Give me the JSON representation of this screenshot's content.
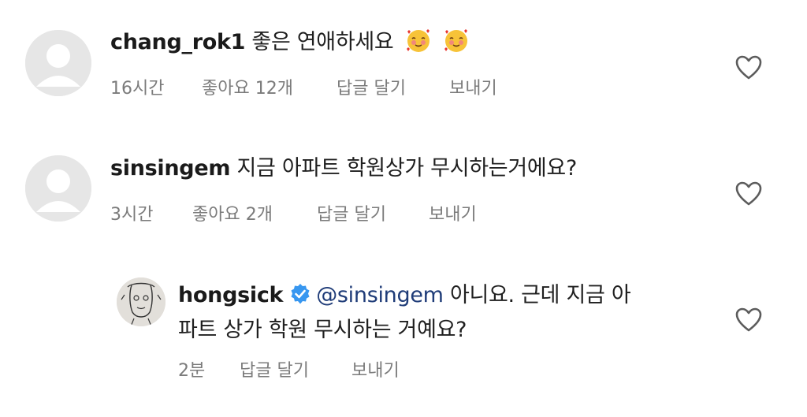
{
  "comments": [
    {
      "username": "chang_rok1",
      "text": "좋은 연애하세요",
      "emoji": [
        "smiling-face-with-hearts",
        "smiling-face-with-hearts"
      ],
      "time": "16시간",
      "likes": "좋아요 12개",
      "reply": "답글 달기",
      "send": "보내기"
    },
    {
      "username": "sinsingem",
      "text": "지금 아파트 학원상가 무시하는거에요?",
      "time": "3시간",
      "likes": "좋아요 2개",
      "reply": "답글 달기",
      "send": "보내기"
    }
  ],
  "reply": {
    "username": "hongsick",
    "verified": true,
    "mention": "@sinsingem",
    "text_line1": "아니요. 근데 지금 아",
    "text_line2": "파트 상가 학원 무시하는 거예요?",
    "time": "2분",
    "reply": "답글 달기",
    "send": "보내기"
  },
  "colors": {
    "text": "#1f1f1f",
    "meta": "#7b7b7b",
    "mention": "#1f3c78",
    "verified": "#3897f0"
  }
}
